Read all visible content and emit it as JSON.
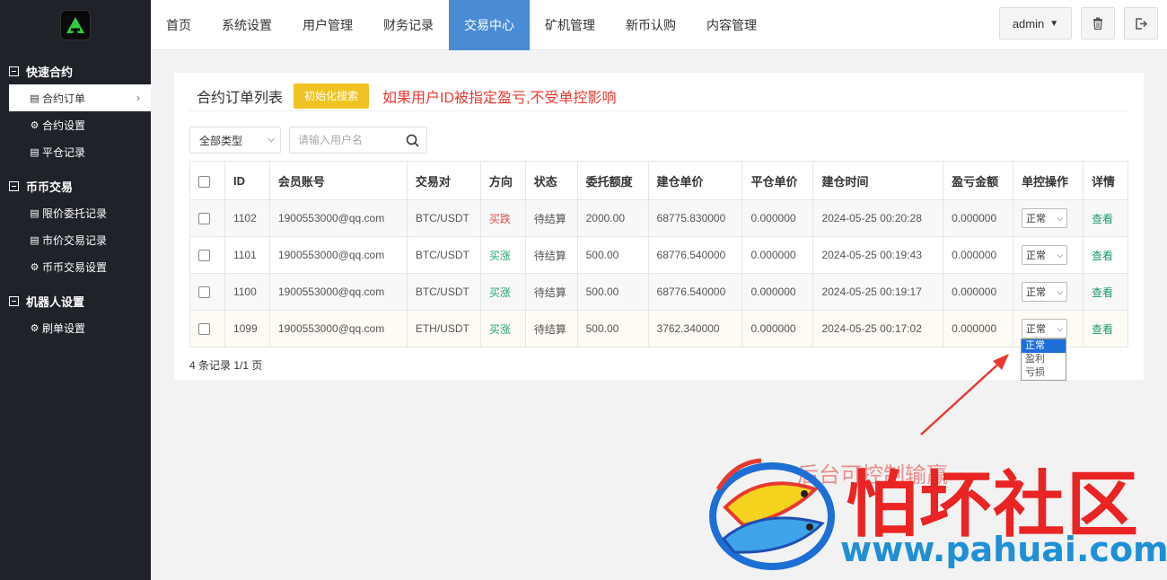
{
  "sidebar": {
    "groups": [
      {
        "label": "快速合约",
        "items": [
          {
            "label": "合约订单",
            "icon": "document-icon",
            "active": true
          },
          {
            "label": "合约设置",
            "icon": "gear-icon"
          },
          {
            "label": "平仓记录",
            "icon": "document-icon"
          }
        ]
      },
      {
        "label": "币币交易",
        "items": [
          {
            "label": "限价委托记录",
            "icon": "document-icon"
          },
          {
            "label": "市价交易记录",
            "icon": "document-icon"
          },
          {
            "label": "币币交易设置",
            "icon": "gear-icon"
          }
        ]
      },
      {
        "label": "机器人设置",
        "items": [
          {
            "label": "刷单设置",
            "icon": "gear-icon"
          }
        ]
      }
    ]
  },
  "nav": {
    "items": [
      "首页",
      "系统设置",
      "用户管理",
      "财务记录",
      "交易中心",
      "矿机管理",
      "新币认购",
      "内容管理"
    ],
    "active_index": 4,
    "user_label": "admin"
  },
  "panel": {
    "title": "合约订单列表",
    "init_button": "初始化搜索",
    "warning": "如果用户ID被指定盈亏,不受单控影响",
    "type_filter": "全部类型",
    "search_placeholder": "请输入用户名"
  },
  "table": {
    "headers": [
      "ID",
      "会员账号",
      "交易对",
      "方向",
      "状态",
      "委托额度",
      "建仓单价",
      "平仓单价",
      "建仓时间",
      "盈亏金额",
      "单控操作",
      "详情"
    ],
    "rows": [
      {
        "id": "1102",
        "account": "1900553000@qq.com",
        "pair": "BTC/USDT",
        "direction": "买跌",
        "status": "待结算",
        "amount": "2000.00",
        "open_price": "68775.830000",
        "close_price": "0.000000",
        "open_time": "2024-05-25 00:20:28",
        "pnl": "0.000000",
        "control": "正常",
        "detail": "查看"
      },
      {
        "id": "1101",
        "account": "1900553000@qq.com",
        "pair": "BTC/USDT",
        "direction": "买涨",
        "status": "待结算",
        "amount": "500.00",
        "open_price": "68776.540000",
        "close_price": "0.000000",
        "open_time": "2024-05-25 00:19:43",
        "pnl": "0.000000",
        "control": "正常",
        "detail": "查看"
      },
      {
        "id": "1100",
        "account": "1900553000@qq.com",
        "pair": "BTC/USDT",
        "direction": "买涨",
        "status": "待结算",
        "amount": "500.00",
        "open_price": "68776.540000",
        "close_price": "0.000000",
        "open_time": "2024-05-25 00:19:17",
        "pnl": "0.000000",
        "control": "正常",
        "detail": "查看"
      },
      {
        "id": "1099",
        "account": "1900553000@qq.com",
        "pair": "ETH/USDT",
        "direction": "买涨",
        "status": "待结算",
        "amount": "500.00",
        "open_price": "3762.340000",
        "close_price": "0.000000",
        "open_time": "2024-05-25 00:17:02",
        "pnl": "0.000000",
        "control": "正常",
        "detail": "查看"
      }
    ],
    "dropdown_options": [
      "正常",
      "盈利",
      "亏损"
    ],
    "footer": "4 条记录 1/1 页"
  },
  "watermark": {
    "title": "怕坏社区",
    "url": "www.pahuai.com",
    "ghost_text": "后台可控制输赢"
  },
  "colors": {
    "sidebar_bg": "#20222a",
    "nav_active": "#4a8bd6",
    "init_button": "#f0c322",
    "warning": "#e8392f",
    "direction_down": "#e24b4b",
    "direction_up": "#22a56b"
  }
}
